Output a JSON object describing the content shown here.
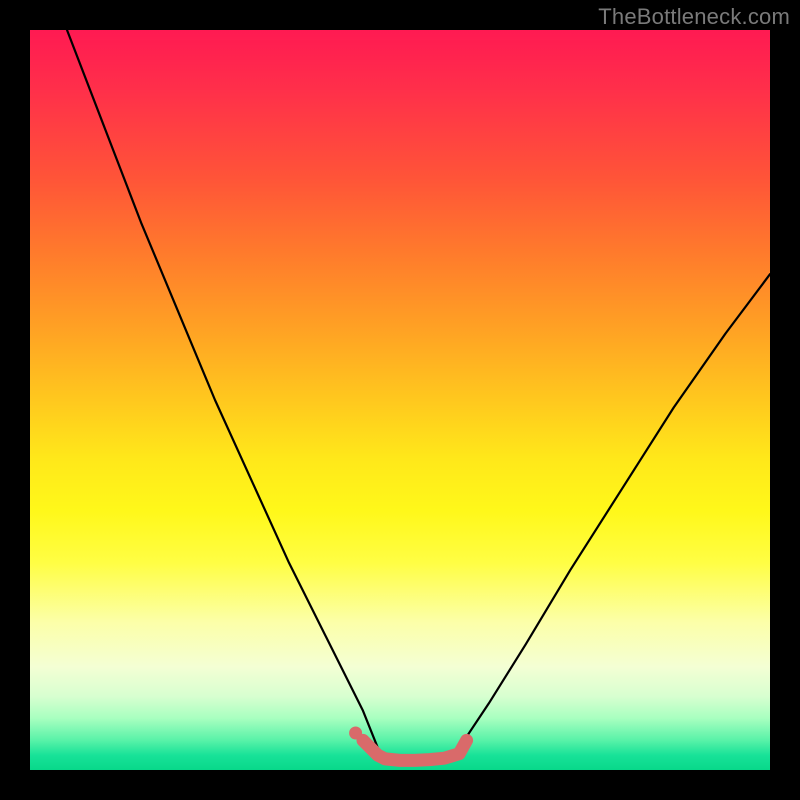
{
  "watermark": "TheBottleneck.com",
  "chart_data": {
    "type": "line",
    "title": "",
    "xlabel": "",
    "ylabel": "",
    "xlim": [
      0,
      100
    ],
    "ylim": [
      0,
      100
    ],
    "grid": false,
    "legend": false,
    "series": [
      {
        "name": "left-curve",
        "color": "#000000",
        "x": [
          5,
          10,
          15,
          20,
          25,
          30,
          35,
          40,
          45,
          47
        ],
        "y": [
          100,
          87,
          74,
          62,
          50,
          39,
          28,
          18,
          8,
          3
        ]
      },
      {
        "name": "right-curve",
        "color": "#000000",
        "x": [
          58,
          62,
          67,
          73,
          80,
          87,
          94,
          100
        ],
        "y": [
          3,
          9,
          17,
          27,
          38,
          49,
          59,
          67
        ]
      },
      {
        "name": "bottom-segment",
        "color": "#d96a6a",
        "x": [
          45,
          47,
          48,
          50,
          52,
          54,
          56,
          58,
          59
        ],
        "y": [
          4,
          2,
          1.5,
          1.3,
          1.3,
          1.4,
          1.6,
          2.2,
          4
        ]
      }
    ],
    "marker": {
      "name": "left-end-dot",
      "color": "#d96a6a",
      "x": 44,
      "y": 5
    },
    "background_gradient": {
      "direction": "vertical",
      "stops": [
        {
          "pos": 0.0,
          "color": "#ff1a52"
        },
        {
          "pos": 0.5,
          "color": "#ffc81e"
        },
        {
          "pos": 0.8,
          "color": "#fcffa8"
        },
        {
          "pos": 1.0,
          "color": "#08d88a"
        }
      ]
    }
  }
}
